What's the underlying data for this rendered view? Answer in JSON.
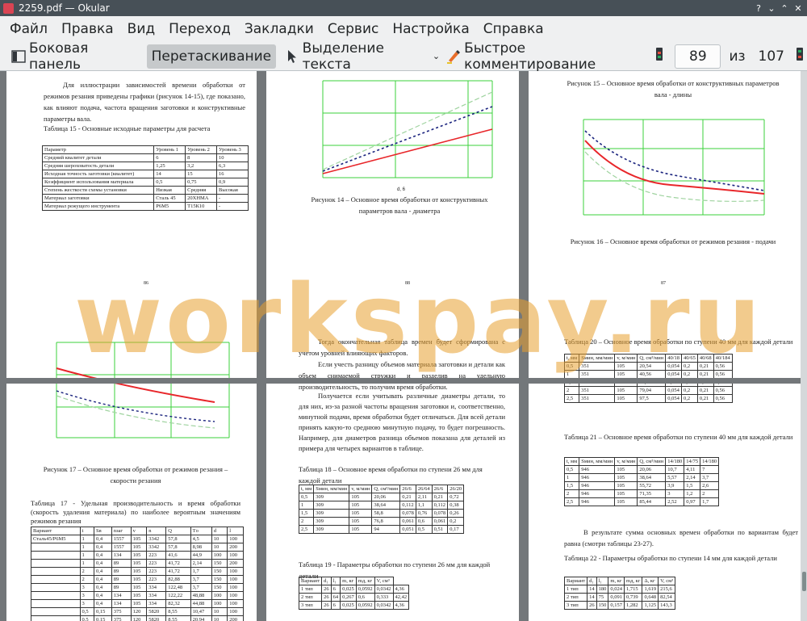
{
  "window": {
    "title": "2259.pdf — Okular"
  },
  "menu": [
    "Файл",
    "Правка",
    "Вид",
    "Переход",
    "Закладки",
    "Сервис",
    "Настройка",
    "Справка"
  ],
  "toolbar": {
    "sidebar": "Боковая панель",
    "drag": "Перетаскивание",
    "select_text": "Выделение текста",
    "quick_comment": "Быстрое комментирование",
    "page_current": "89",
    "page_of": "из",
    "page_total": "107"
  },
  "watermark": "workspay.ru",
  "pages": {
    "p1": {
      "para": "Для иллюстрации зависимостей времени обработки от режимов резания приведены графики (рисунок 14-15), где показано, как влияют подача, частота вращения заготовки и конструктивные параметры вала.",
      "table_caption": "Таблица 15 - Основные исходные параметры для расчета",
      "table": [
        [
          "Параметр",
          "Уровень 1",
          "Уровень 2",
          "Уровень 3"
        ],
        [
          "Средний квалитет детали",
          "6",
          "8",
          "10"
        ],
        [
          "Средняя шероховатость детали",
          "1,25",
          "3,2",
          "6,3"
        ],
        [
          "Исходная точность заготовки (квалитет)",
          "14",
          "15",
          "16"
        ],
        [
          "Коэффициент использования материала",
          "0,5",
          "0,75",
          "0,9"
        ],
        [
          "Степень жесткости схемы установки",
          "Низкая",
          "Средняя",
          "Высокая"
        ],
        [
          "Материал заготовки",
          "Сталь 45",
          "20ХНМА",
          "-"
        ],
        [
          "Материал режущего инструмента",
          "Р6М5",
          "Т15К10",
          "-"
        ]
      ],
      "page_no": "86"
    },
    "p2": {
      "caption": "Рисунок 14 – Основное время обработки от конструктивных параметров вала - диаметра",
      "xlabel": "d, 6",
      "page_no": "88"
    },
    "p3": {
      "caption_top": "Рисунок 15 – Основное время обработки от конструктивных параметров вала - длины",
      "caption": "Рисунок 16 – Основное время обработки от режимов резания - подачи",
      "page_no": "87"
    },
    "p4": {
      "caption": "Рисунок 17 – Основное время обработки от режимов резания – скорости резания",
      "table_caption": "Таблица 17 - Удельная производительность и время обработки (скорость удаления материала) по наиболее вероятным значениям режимов резания",
      "table_header": [
        "Вариант",
        "t",
        "Sв",
        "nзаг",
        "v",
        "n",
        "Q",
        "Tо",
        "d",
        "l"
      ],
      "table": [
        [
          "Сталь45/Р6М5",
          "1",
          "0,4",
          "1557",
          "105",
          "3342",
          "57,8",
          "4,5",
          "10",
          "100"
        ],
        [
          "",
          "1",
          "0,4",
          "1557",
          "105",
          "3342",
          "57,8",
          "8,98",
          "10",
          "200"
        ],
        [
          "",
          "1",
          "0,4",
          "134",
          "105",
          "223",
          "41,6",
          "44,9",
          "100",
          "100"
        ],
        [
          "",
          "1",
          "0,4",
          "89",
          "105",
          "223",
          "41,72",
          "2,14",
          "150",
          "200"
        ],
        [
          "",
          "2",
          "0,4",
          "89",
          "105",
          "223",
          "41,72",
          "1,7",
          "150",
          "100"
        ],
        [
          "",
          "2",
          "0,4",
          "89",
          "105",
          "223",
          "82,88",
          "3,7",
          "150",
          "100"
        ],
        [
          "",
          "3",
          "0,4",
          "89",
          "105",
          "334",
          "122,48",
          "3,7",
          "150",
          "100"
        ],
        [
          "",
          "3",
          "0,4",
          "134",
          "105",
          "334",
          "122,22",
          "48,88",
          "100",
          "100"
        ],
        [
          "",
          "3",
          "0,4",
          "134",
          "105",
          "334",
          "82,32",
          "44,88",
          "100",
          "100"
        ],
        [
          "",
          "0,5",
          "0,15",
          "375",
          "120",
          "5820",
          "8,55",
          "10,47",
          "10",
          "100"
        ],
        [
          "",
          "0,5",
          "0,15",
          "375",
          "120",
          "5820",
          "8,55",
          "20,94",
          "10",
          "200"
        ]
      ]
    },
    "p5": {
      "para1": "Тогда окончательная таблица времен будет сформирована с учетом уровней влияющих факторов.",
      "para2": "Если учесть разницу объемов материала заготовки и детали как объем снимаемой стружки и разделив на удельную производительность, то получим время обработки.",
      "para3": "Получается если учитывать различные диаметры детали, то для них, из-за разной частоты вращения заготовки и, соответственно, минутной подачи, время обработки будет отличаться. Для всей детали принять какую-то среднюю минутную подачу, то будет погрешность. Например, для диаметров разница объемов показана для деталей из примера для четырех вариантов в таблице.",
      "table18_caption": "Таблица 18 – Основное время обработки по ступени 26 мм для каждой детали",
      "table18_header": [
        "t, мм",
        "Sмин, мм/мин",
        "v, м/мин",
        "Q, см³/мин",
        "26/6",
        "26/64",
        "26/6",
        "26/20"
      ],
      "table18": [
        [
          "0,5",
          "309",
          "105",
          "20,06",
          "0,21",
          "2,11",
          "0,21",
          "0,72"
        ],
        [
          "1",
          "309",
          "105",
          "38,64",
          "0,112",
          "1,1",
          "0,112",
          "0,38"
        ],
        [
          "1,5",
          "309",
          "105",
          "58,8",
          "0,078",
          "0,76",
          "0,078",
          "0,26"
        ],
        [
          "2",
          "309",
          "105",
          "76,8",
          "0,061",
          "0,6",
          "0,061",
          "0,2"
        ],
        [
          "2,5",
          "309",
          "105",
          "94",
          "0,051",
          "0,5",
          "0,51",
          "0,17"
        ]
      ],
      "table19_caption": "Таблица 19 - Параметры обработки по ступени 26 мм для каждой детали",
      "table19_header": [
        "Вариант",
        "d₁",
        "l₁",
        "m, кг",
        "mд, кг",
        "V, см³"
      ],
      "table19": [
        [
          "1 тип",
          "26",
          "6",
          "0,025",
          "0,0592",
          "0,0342",
          "4,36"
        ],
        [
          "2 тип",
          "26",
          "64",
          "0,267",
          "0,6",
          "0,333",
          "42,42"
        ],
        [
          "3 тип",
          "26",
          "6",
          "0,025",
          "0,0592",
          "0,0342",
          "4,36"
        ]
      ]
    },
    "p6": {
      "table20_caption": "Таблица 20 – Основное время обработки по ступени 40 мм для каждой детали",
      "table20_header": [
        "t, мм",
        "Sмин, мм/мин",
        "v, м/мин",
        "Q, см³/мин",
        "40/18",
        "40/65",
        "40/68",
        "40/184"
      ],
      "table20": [
        [
          "0,5",
          "351",
          "105",
          "20,54",
          "0,054",
          "0,2",
          "0,21",
          "0,56"
        ],
        [
          "1",
          "351",
          "105",
          "40,56",
          "0,054",
          "0,2",
          "0,21",
          "0,56"
        ],
        [
          "1,5",
          "351",
          "105",
          "60,06",
          "0,054",
          "0,2",
          "0,21",
          "0,56"
        ],
        [
          "2",
          "351",
          "105",
          "79,04",
          "0,054",
          "0,2",
          "0,21",
          "0,56"
        ],
        [
          "2,5",
          "351",
          "105",
          "97,5",
          "0,054",
          "0,2",
          "0,21",
          "0,56"
        ]
      ],
      "table21_caption": "Таблица 21 – Основное время обработки по ступени 40 мм для каждой детали",
      "table21_header": [
        "t, мм",
        "Sмин, мм/мин",
        "v, м/мин",
        "Q, см³/мин",
        "14/180",
        "14/75",
        "14/180"
      ],
      "table21": [
        [
          "0,5",
          "946",
          "105",
          "20,06",
          "10,7",
          "4,11",
          "7"
        ],
        [
          "1",
          "946",
          "105",
          "38,64",
          "5,57",
          "2,14",
          "3,7"
        ],
        [
          "1,5",
          "946",
          "105",
          "55,72",
          "3,9",
          "1,5",
          "2,6"
        ],
        [
          "2",
          "946",
          "105",
          "71,35",
          "3",
          "1,2",
          "2"
        ],
        [
          "2,5",
          "946",
          "105",
          "85,44",
          "2,52",
          "0,97",
          "1,7"
        ]
      ],
      "para": "В результате сумма основных времен обработки по вариантам будет равна (смотри таблицы 23-27).",
      "table22_caption": "Таблица 22 - Параметры обработки по ступени 14 мм для каждой детали",
      "table22_header": [
        "Вариант",
        "d₁",
        "l₁",
        "m, кг",
        "mд, кг",
        "Δ, кг",
        "V, см³"
      ],
      "table22": [
        [
          "1 тип",
          "14",
          "180",
          "0,024",
          "1,715",
          "1,619",
          "215,6"
        ],
        [
          "2 тип",
          "14",
          "75",
          "0,091",
          "0,739",
          "0,648",
          "82,54"
        ],
        [
          "3 тип",
          "26",
          "150",
          "0,157",
          "1,282",
          "1,125",
          "143,3"
        ]
      ]
    }
  },
  "colors": {
    "chrome_bg": "#eff0f1",
    "titlebar": "#475057",
    "active_tool": "#c6c9cb",
    "watermark": "#e8a030",
    "grid_green": "#3bd23b",
    "red_curve": "#e8262a"
  }
}
